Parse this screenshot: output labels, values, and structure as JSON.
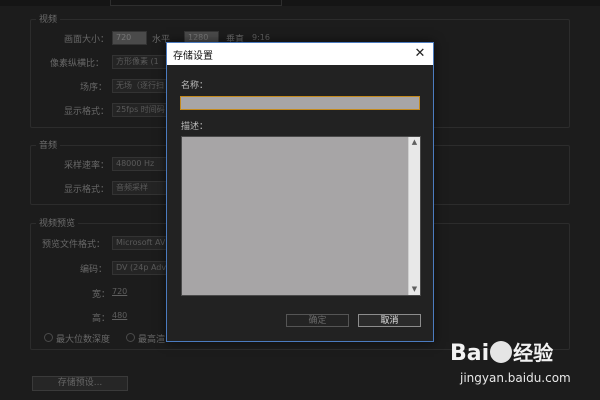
{
  "background": {
    "video_group": {
      "title": "视频",
      "frame_size_label": "画面大小：",
      "frame_width": "720",
      "horizontal_label": "水平",
      "frame_height": "1280",
      "vertical_label": "垂直",
      "aspect": "9:16",
      "pixel_aspect_label": "像素纵横比：",
      "pixel_aspect_value": "方形像素 (1",
      "field_order_label": "场序：",
      "field_order_value": "无场（逐行扫",
      "display_format_label": "显示格式：",
      "display_format_value": "25fps 时间码"
    },
    "audio_group": {
      "title": "音频",
      "sample_rate_label": "采样速率：",
      "sample_rate_value": "48000 Hz",
      "display_format_label": "显示格式：",
      "display_format_value": "音频采样"
    },
    "preview_group": {
      "title": "视频预览",
      "preview_format_label": "预览文件格式：",
      "preview_format_value": "Microsoft AVI",
      "codec_label": "编码：",
      "codec_value": "DV (24p Adv",
      "width_label": "宽：",
      "width_value": "720",
      "height_label": "高：",
      "height_value": "480",
      "max_bit_depth_label": "最大位数深度",
      "max_quality_label": "最高渲"
    },
    "save_preset_button": "存储预设..."
  },
  "dialog": {
    "title": "存储设置",
    "close_glyph": "✕",
    "name_label": "名称：",
    "name_value": "",
    "description_label": "描述：",
    "description_value": "",
    "scroll_up_glyph": "▲",
    "scroll_down_glyph": "▼",
    "ok_label": "确定",
    "cancel_label": "取消",
    "accent_color": "#c48a1e"
  },
  "watermark": {
    "logo_left": "Bai",
    "logo_right": "经验",
    "url": "jingyan.baidu.com"
  }
}
